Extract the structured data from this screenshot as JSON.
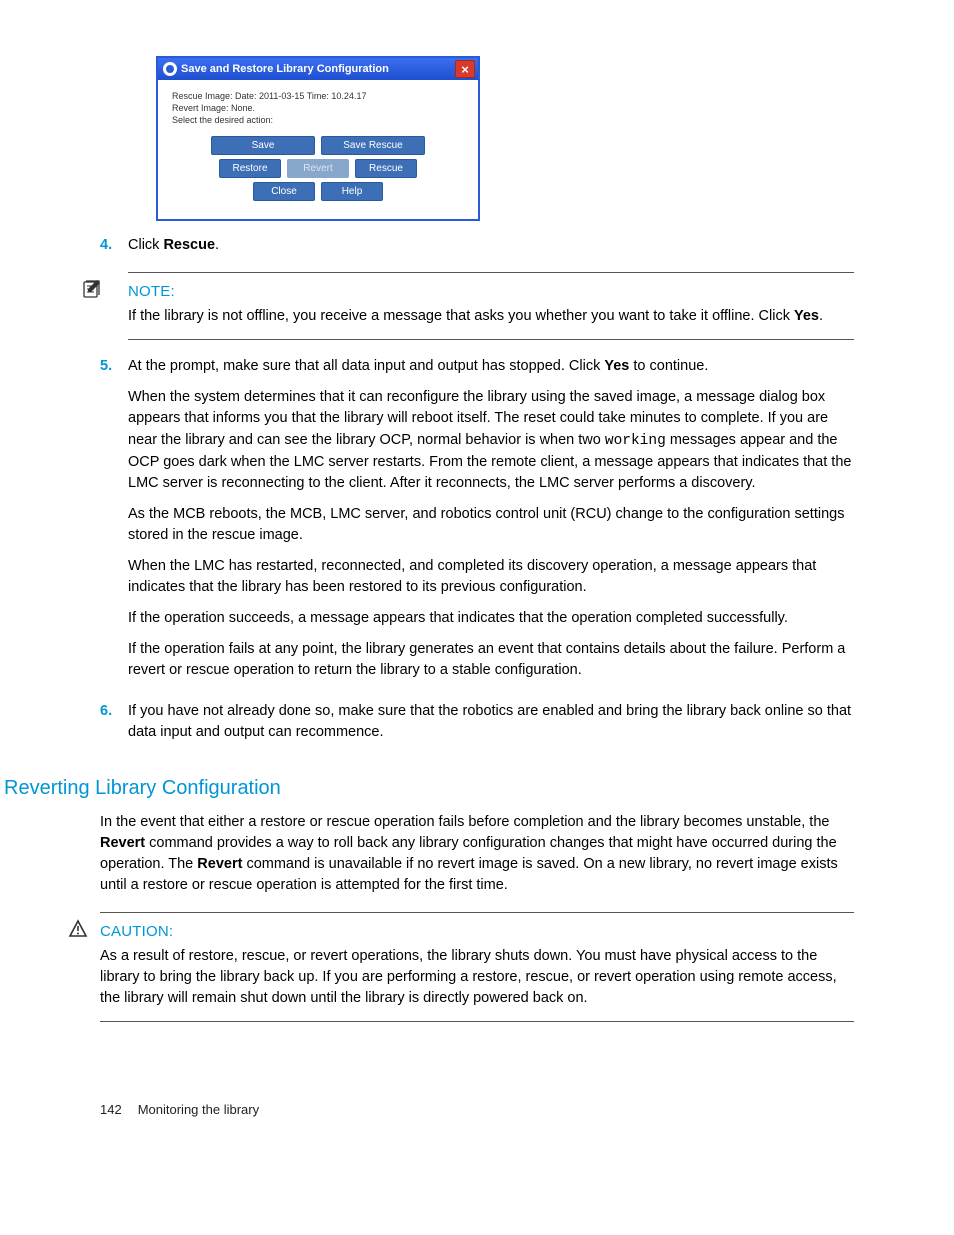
{
  "dialog": {
    "title": "Save and Restore Library Configuration",
    "line1": "Rescue Image: Date: 2011-03-15 Time: 10.24.17",
    "line2": "Revert Image: None.",
    "line3": "Select the desired action:",
    "btn_save": "Save",
    "btn_save_rescue": "Save Rescue",
    "btn_restore": "Restore",
    "btn_revert": "Revert",
    "btn_rescue": "Rescue",
    "btn_close": "Close",
    "btn_help": "Help"
  },
  "steps": {
    "s4_num": "4.",
    "s4_a": "Click ",
    "s4_b": "Rescue",
    "s4_c": ".",
    "s5_num": "5.",
    "s5_line1_a": "At the prompt, make sure that all data input and output has stopped. Click ",
    "s5_line1_b": "Yes",
    "s5_line1_c": " to continue.",
    "s5_p2_a": "When the system determines that it can reconfigure the library using the saved image, a message dialog box appears that informs you that the library will reboot itself. The reset could take minutes to complete. If you are near the library and can see the library OCP, normal behavior is when two ",
    "s5_p2_code": "working",
    "s5_p2_b": " messages appear and the OCP goes dark when the LMC server restarts. From the remote client, a message appears that indicates that the LMC server is reconnecting to the client. After it reconnects, the LMC server performs a discovery.",
    "s5_p3": "As the MCB reboots, the MCB, LMC server, and robotics control unit (RCU) change to the configuration settings stored in the rescue image.",
    "s5_p4": "When the LMC has restarted, reconnected, and completed its discovery operation, a message appears that indicates that the library has been restored to its previous configuration.",
    "s5_p5": "If the operation succeeds, a message appears that indicates that the operation completed successfully.",
    "s5_p6": "If the operation fails at any point, the library generates an event that contains details about the failure. Perform a revert or rescue operation to return the library to a stable configuration.",
    "s6_num": "6.",
    "s6_text": "If you have not already done so, make sure that the robotics are enabled and bring the library back online so that data input and output can recommence."
  },
  "note": {
    "title": "NOTE:",
    "body_a": "If the library is not offline, you receive a message that asks you whether you want to take it offline. Click ",
    "body_b": "Yes",
    "body_c": "."
  },
  "section": {
    "heading": "Reverting Library Configuration",
    "p_a": "In the event that either a restore or rescue operation fails before completion and the library becomes unstable, the ",
    "p_b": "Revert",
    "p_c": " command provides a way to roll back any library configuration changes that might have occurred during the operation. The ",
    "p_d": "Revert",
    "p_e": " command is unavailable if no revert image is saved. On a new library, no revert image exists until a restore or rescue operation is attempted for the first time."
  },
  "caution": {
    "title": "CAUTION:",
    "body": "As a result of restore, rescue, or revert operations, the library shuts down. You must have physical access to the library to bring the library back up. If you are performing a restore, rescue, or revert operation using remote access, the library will remain shut down until the library is directly powered back on."
  },
  "footer": {
    "pagenum": "142",
    "section": "Monitoring the library"
  }
}
